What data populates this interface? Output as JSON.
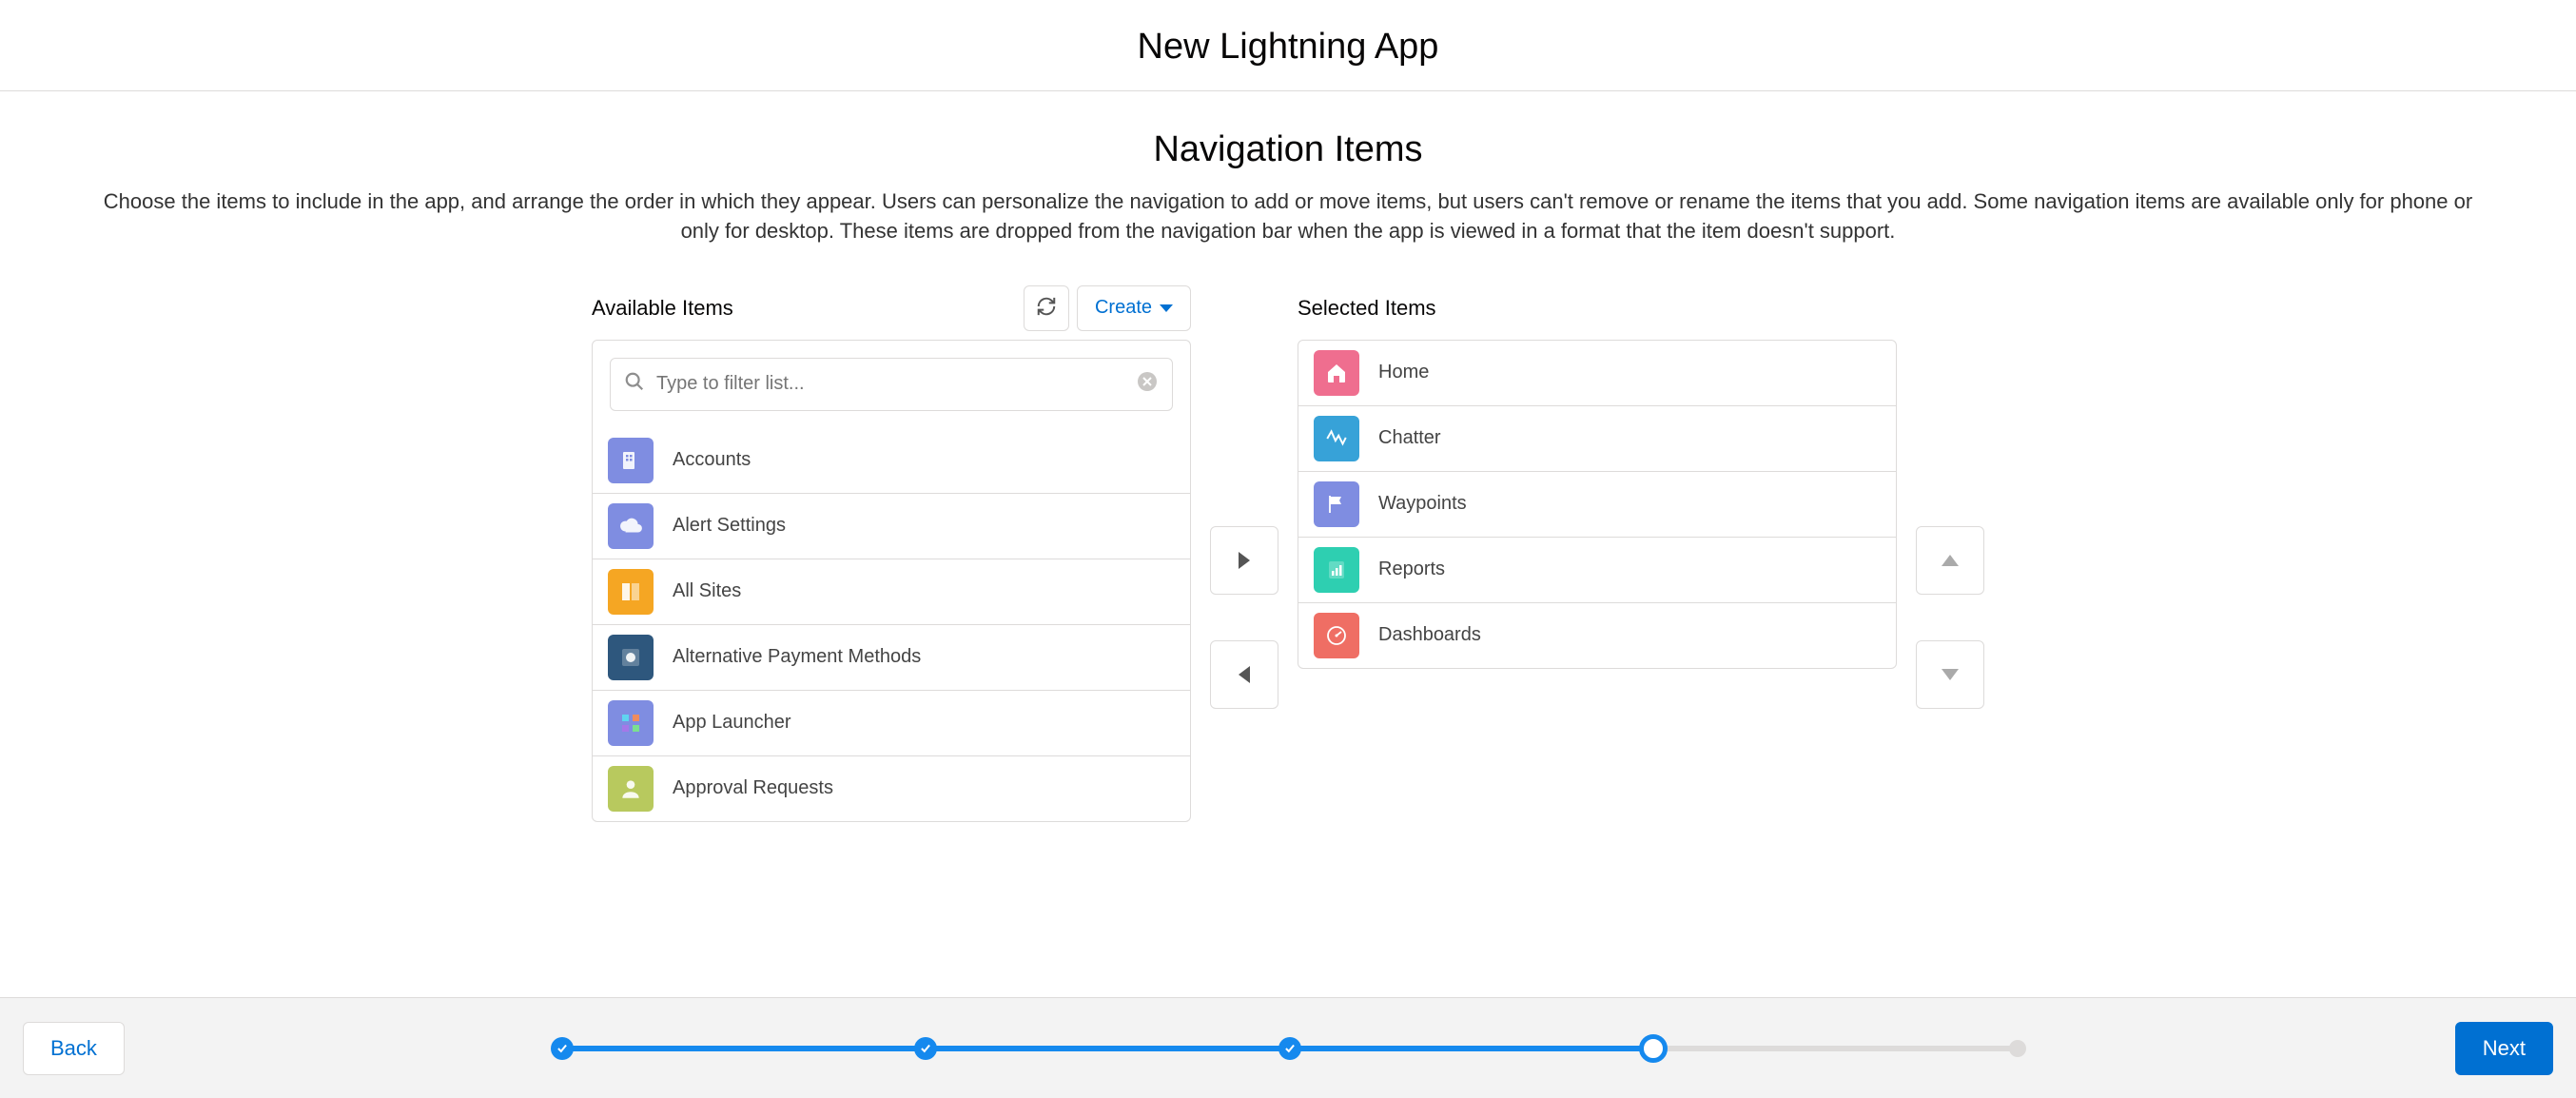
{
  "header": {
    "title": "New Lightning App"
  },
  "section": {
    "title": "Navigation Items",
    "description": "Choose the items to include in the app, and arrange the order in which they appear. Users can personalize the navigation to add or move items, but users can't remove or rename the items that you add. Some navigation items are available only for phone or only for desktop. These items are dropped from the navigation bar when the app is viewed in a format that the item doesn't support."
  },
  "available": {
    "title": "Available Items",
    "create_label": "Create",
    "search_placeholder": "Type to filter list..."
  },
  "selected": {
    "title": "Selected Items"
  },
  "available_items": [
    {
      "label": "Accounts",
      "color": "#7f8de1",
      "icon": "account"
    },
    {
      "label": "Alert Settings",
      "color": "#7f8de1",
      "icon": "cloud"
    },
    {
      "label": "All Sites",
      "color": "#f5a623",
      "icon": "sites"
    },
    {
      "label": "Alternative Payment Methods",
      "color": "#2e577d",
      "icon": "payment"
    },
    {
      "label": "App Launcher",
      "color": "#7f8de1",
      "icon": "apps"
    },
    {
      "label": "Approval Requests",
      "color": "#b8c95e",
      "icon": "approval"
    }
  ],
  "selected_items": [
    {
      "label": "Home",
      "color": "#ef6e8f",
      "icon": "home"
    },
    {
      "label": "Chatter",
      "color": "#37a2d8",
      "icon": "chatter"
    },
    {
      "label": "Waypoints",
      "color": "#7f8de1",
      "icon": "flag"
    },
    {
      "label": "Reports",
      "color": "#2ecfb1",
      "icon": "report"
    },
    {
      "label": "Dashboards",
      "color": "#ef6e64",
      "icon": "gauge"
    }
  ],
  "footer": {
    "back": "Back",
    "next": "Next"
  },
  "progress": {
    "total": 5,
    "current": 4
  }
}
